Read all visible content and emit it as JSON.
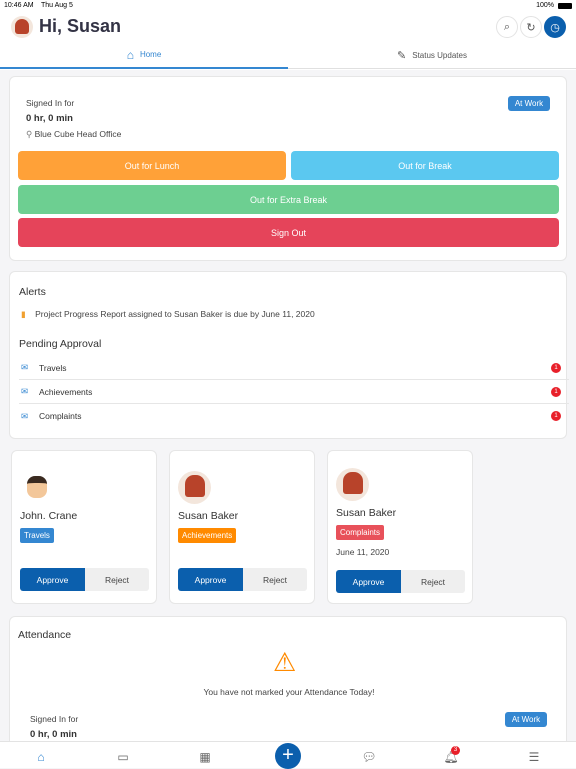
{
  "status_bar": {
    "time": "10:46 AM",
    "date": "Thu Aug 5",
    "battery": "100%"
  },
  "header": {
    "title": "Hi, Susan"
  },
  "tabs": [
    {
      "label": "Home",
      "active": true
    },
    {
      "label": "Status Updates",
      "active": false
    }
  ],
  "attendance_card": {
    "signed_in_label": "Signed In for",
    "duration": "0 hr, 0 min",
    "location": "Blue Cube Head Office",
    "status": "At Work",
    "buttons": {
      "lunch": "Out for Lunch",
      "break": "Out for Break",
      "extra": "Out for Extra Break",
      "signout": "Sign Out"
    }
  },
  "alerts": {
    "title": "Alerts",
    "items": [
      "Project Progress Report assigned to Susan Baker is due by June 11, 2020"
    ]
  },
  "pending": {
    "title": "Pending Approval",
    "items": [
      {
        "label": "Travels",
        "count": "1"
      },
      {
        "label": "Achievements",
        "count": "1"
      },
      {
        "label": "Complaints",
        "count": "1"
      }
    ]
  },
  "approvals": [
    {
      "name": "John. Crane",
      "tag": "Travels",
      "tag_color": "#3487d1",
      "date": "",
      "approve": "Approve",
      "reject": "Reject"
    },
    {
      "name": "Susan Baker",
      "tag": "Achievements",
      "tag_color": "#ff8a00",
      "date": "",
      "approve": "Approve",
      "reject": "Reject"
    },
    {
      "name": "Susan Baker",
      "tag": "Complaints",
      "tag_color": "#e8515a",
      "date": "June 11, 2020",
      "approve": "Approve",
      "reject": "Reject"
    }
  ],
  "attendance": {
    "title": "Attendance",
    "warning": "You have not marked your Attendance Today!",
    "signed_in_label": "Signed In for",
    "duration": "0 hr, 0 min",
    "status": "At Work"
  },
  "bottom_nav": {
    "notification_count": "3"
  },
  "colors": {
    "primary": "#0b5fad",
    "lunch": "#ffa138",
    "break": "#5bc8f0",
    "extra": "#6dcf91",
    "signout": "#e5445a"
  }
}
